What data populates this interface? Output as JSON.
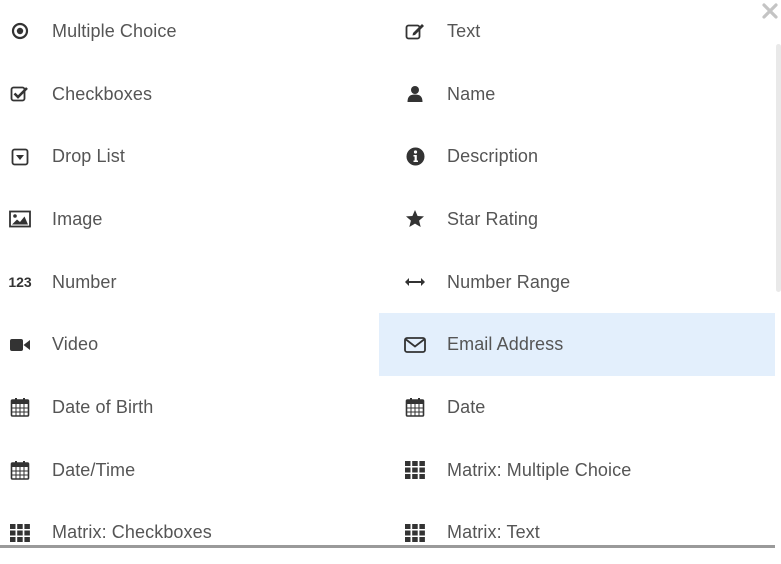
{
  "close_icon": "close-icon",
  "colors": {
    "highlight": "#e3effc",
    "icon": "#333333",
    "text": "#555555"
  },
  "items": [
    {
      "label": "Multiple Choice",
      "icon": "radio-icon"
    },
    {
      "label": "Text",
      "icon": "edit-icon"
    },
    {
      "label": "Checkboxes",
      "icon": "checkbox-icon"
    },
    {
      "label": "Name",
      "icon": "user-icon"
    },
    {
      "label": "Drop List",
      "icon": "dropdown-icon"
    },
    {
      "label": "Description",
      "icon": "info-icon"
    },
    {
      "label": "Image",
      "icon": "image-icon"
    },
    {
      "label": "Star Rating",
      "icon": "star-icon"
    },
    {
      "label": "Number",
      "icon": "number-icon",
      "icon_text": "123"
    },
    {
      "label": "Number Range",
      "icon": "range-arrow-icon"
    },
    {
      "label": "Video",
      "icon": "video-icon"
    },
    {
      "label": "Email Address",
      "icon": "envelope-icon",
      "highlighted": true
    },
    {
      "label": "Date of Birth",
      "icon": "calendar-icon"
    },
    {
      "label": "Date",
      "icon": "calendar-icon"
    },
    {
      "label": "Date/Time",
      "icon": "calendar-icon"
    },
    {
      "label": "Matrix: Multiple Choice",
      "icon": "grid-icon"
    },
    {
      "label": "Matrix: Checkboxes",
      "icon": "grid-icon"
    },
    {
      "label": "Matrix: Text",
      "icon": "grid-icon"
    }
  ]
}
